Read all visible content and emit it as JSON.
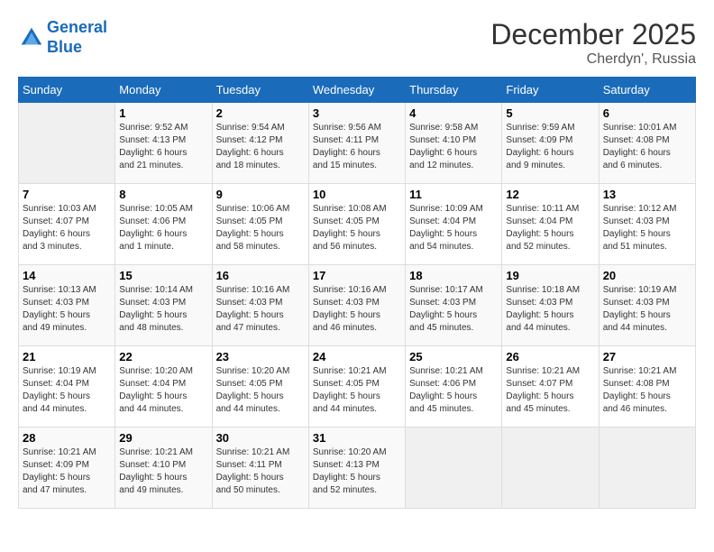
{
  "logo": {
    "line1": "General",
    "line2": "Blue"
  },
  "title": "December 2025",
  "location": "Cherdyn', Russia",
  "weekdays": [
    "Sunday",
    "Monday",
    "Tuesday",
    "Wednesday",
    "Thursday",
    "Friday",
    "Saturday"
  ],
  "weeks": [
    [
      {
        "day": "",
        "info": ""
      },
      {
        "day": "1",
        "info": "Sunrise: 9:52 AM\nSunset: 4:13 PM\nDaylight: 6 hours\nand 21 minutes."
      },
      {
        "day": "2",
        "info": "Sunrise: 9:54 AM\nSunset: 4:12 PM\nDaylight: 6 hours\nand 18 minutes."
      },
      {
        "day": "3",
        "info": "Sunrise: 9:56 AM\nSunset: 4:11 PM\nDaylight: 6 hours\nand 15 minutes."
      },
      {
        "day": "4",
        "info": "Sunrise: 9:58 AM\nSunset: 4:10 PM\nDaylight: 6 hours\nand 12 minutes."
      },
      {
        "day": "5",
        "info": "Sunrise: 9:59 AM\nSunset: 4:09 PM\nDaylight: 6 hours\nand 9 minutes."
      },
      {
        "day": "6",
        "info": "Sunrise: 10:01 AM\nSunset: 4:08 PM\nDaylight: 6 hours\nand 6 minutes."
      }
    ],
    [
      {
        "day": "7",
        "info": "Sunrise: 10:03 AM\nSunset: 4:07 PM\nDaylight: 6 hours\nand 3 minutes."
      },
      {
        "day": "8",
        "info": "Sunrise: 10:05 AM\nSunset: 4:06 PM\nDaylight: 6 hours\nand 1 minute."
      },
      {
        "day": "9",
        "info": "Sunrise: 10:06 AM\nSunset: 4:05 PM\nDaylight: 5 hours\nand 58 minutes."
      },
      {
        "day": "10",
        "info": "Sunrise: 10:08 AM\nSunset: 4:05 PM\nDaylight: 5 hours\nand 56 minutes."
      },
      {
        "day": "11",
        "info": "Sunrise: 10:09 AM\nSunset: 4:04 PM\nDaylight: 5 hours\nand 54 minutes."
      },
      {
        "day": "12",
        "info": "Sunrise: 10:11 AM\nSunset: 4:04 PM\nDaylight: 5 hours\nand 52 minutes."
      },
      {
        "day": "13",
        "info": "Sunrise: 10:12 AM\nSunset: 4:03 PM\nDaylight: 5 hours\nand 51 minutes."
      }
    ],
    [
      {
        "day": "14",
        "info": "Sunrise: 10:13 AM\nSunset: 4:03 PM\nDaylight: 5 hours\nand 49 minutes."
      },
      {
        "day": "15",
        "info": "Sunrise: 10:14 AM\nSunset: 4:03 PM\nDaylight: 5 hours\nand 48 minutes."
      },
      {
        "day": "16",
        "info": "Sunrise: 10:16 AM\nSunset: 4:03 PM\nDaylight: 5 hours\nand 47 minutes."
      },
      {
        "day": "17",
        "info": "Sunrise: 10:16 AM\nSunset: 4:03 PM\nDaylight: 5 hours\nand 46 minutes."
      },
      {
        "day": "18",
        "info": "Sunrise: 10:17 AM\nSunset: 4:03 PM\nDaylight: 5 hours\nand 45 minutes."
      },
      {
        "day": "19",
        "info": "Sunrise: 10:18 AM\nSunset: 4:03 PM\nDaylight: 5 hours\nand 44 minutes."
      },
      {
        "day": "20",
        "info": "Sunrise: 10:19 AM\nSunset: 4:03 PM\nDaylight: 5 hours\nand 44 minutes."
      }
    ],
    [
      {
        "day": "21",
        "info": "Sunrise: 10:19 AM\nSunset: 4:04 PM\nDaylight: 5 hours\nand 44 minutes."
      },
      {
        "day": "22",
        "info": "Sunrise: 10:20 AM\nSunset: 4:04 PM\nDaylight: 5 hours\nand 44 minutes."
      },
      {
        "day": "23",
        "info": "Sunrise: 10:20 AM\nSunset: 4:05 PM\nDaylight: 5 hours\nand 44 minutes."
      },
      {
        "day": "24",
        "info": "Sunrise: 10:21 AM\nSunset: 4:05 PM\nDaylight: 5 hours\nand 44 minutes."
      },
      {
        "day": "25",
        "info": "Sunrise: 10:21 AM\nSunset: 4:06 PM\nDaylight: 5 hours\nand 45 minutes."
      },
      {
        "day": "26",
        "info": "Sunrise: 10:21 AM\nSunset: 4:07 PM\nDaylight: 5 hours\nand 45 minutes."
      },
      {
        "day": "27",
        "info": "Sunrise: 10:21 AM\nSunset: 4:08 PM\nDaylight: 5 hours\nand 46 minutes."
      }
    ],
    [
      {
        "day": "28",
        "info": "Sunrise: 10:21 AM\nSunset: 4:09 PM\nDaylight: 5 hours\nand 47 minutes."
      },
      {
        "day": "29",
        "info": "Sunrise: 10:21 AM\nSunset: 4:10 PM\nDaylight: 5 hours\nand 49 minutes."
      },
      {
        "day": "30",
        "info": "Sunrise: 10:21 AM\nSunset: 4:11 PM\nDaylight: 5 hours\nand 50 minutes."
      },
      {
        "day": "31",
        "info": "Sunrise: 10:20 AM\nSunset: 4:13 PM\nDaylight: 5 hours\nand 52 minutes."
      },
      {
        "day": "",
        "info": ""
      },
      {
        "day": "",
        "info": ""
      },
      {
        "day": "",
        "info": ""
      }
    ]
  ]
}
